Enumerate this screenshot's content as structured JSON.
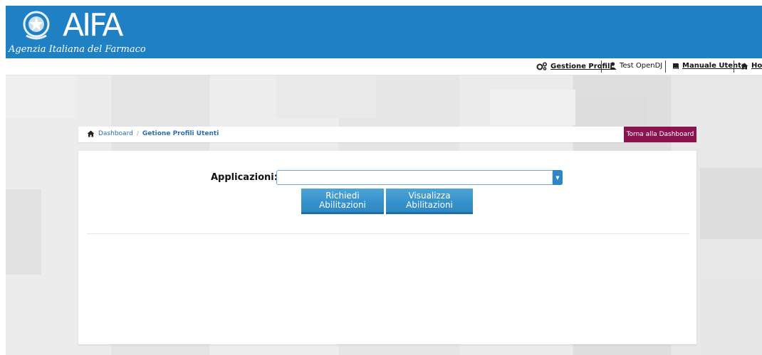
{
  "header": {
    "logo_text": "AIFA",
    "logo_subtitle": "Agenzia Italiana del Farmaco"
  },
  "topnav": {
    "gestione_profili": "Gestione Profili",
    "user": "Test OpenDJ",
    "manuale": "Manuale Utente",
    "home": "Home"
  },
  "breadcrumb": {
    "dashboard": "Dashboard",
    "separator": "/",
    "current": "Getione Profili Utenti",
    "back_button": "Torna alla Dashboard"
  },
  "form": {
    "applicazioni_label": "Applicazioni:",
    "applicazioni_value": "",
    "btn_richiedi_line1": "Richiedi",
    "btn_richiedi_line2": "Abilitazioni",
    "btn_visualizza_line1": "Visualizza",
    "btn_visualizza_line2": "Abilitazioni"
  },
  "colors": {
    "header_blue": "#1f81c4",
    "back_button": "#8a1350",
    "button_blue": "#3591cb"
  }
}
